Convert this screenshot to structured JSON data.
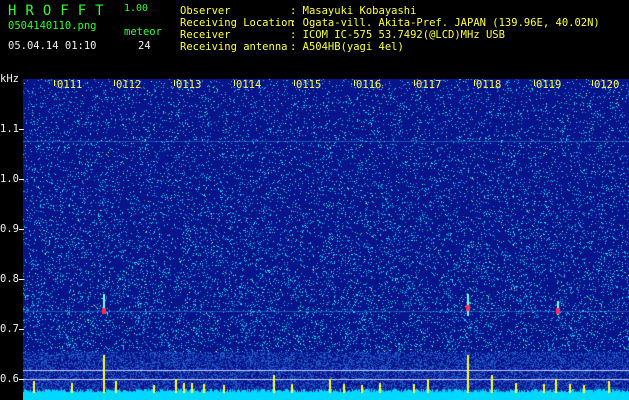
{
  "header": {
    "app_name": "HROFFT",
    "version": "1.00",
    "filename": "0504140110.png",
    "meteor_label": "meteor",
    "datetime": "05.04.14 01:10",
    "meteor_count": "24",
    "info": [
      {
        "label": "Observer",
        "value": ": Masayuki Kobayashi"
      },
      {
        "label": "Receiving Location",
        "value": ": Ogata-vill. Akita-Pref. JAPAN (139.96E, 40.02N)"
      },
      {
        "label": "Receiver",
        "value": ": ICOM IC-575 53.7492(@LCD)MHz USB"
      },
      {
        "label": "Receiving antenna",
        "value": ": A504HB(yagi 4el)"
      }
    ]
  },
  "axis": {
    "unit": "kHz",
    "y_ticks": [
      "1.1",
      "1.0",
      "0.9",
      "0.8",
      "0.7",
      "0.6"
    ],
    "x_ticks": [
      "0111",
      "0112",
      "0113",
      "0114",
      "0115",
      "0116",
      "0117",
      "0118",
      "0119",
      "0120"
    ]
  },
  "colors": {
    "background": "#000000",
    "header_green": "#2dff2d",
    "header_white": "#f0f0f0",
    "tick_yellow": "#ffff40",
    "spectrogram_base": "#0a1a8c",
    "signal_cyan": "#00e0ff"
  }
}
